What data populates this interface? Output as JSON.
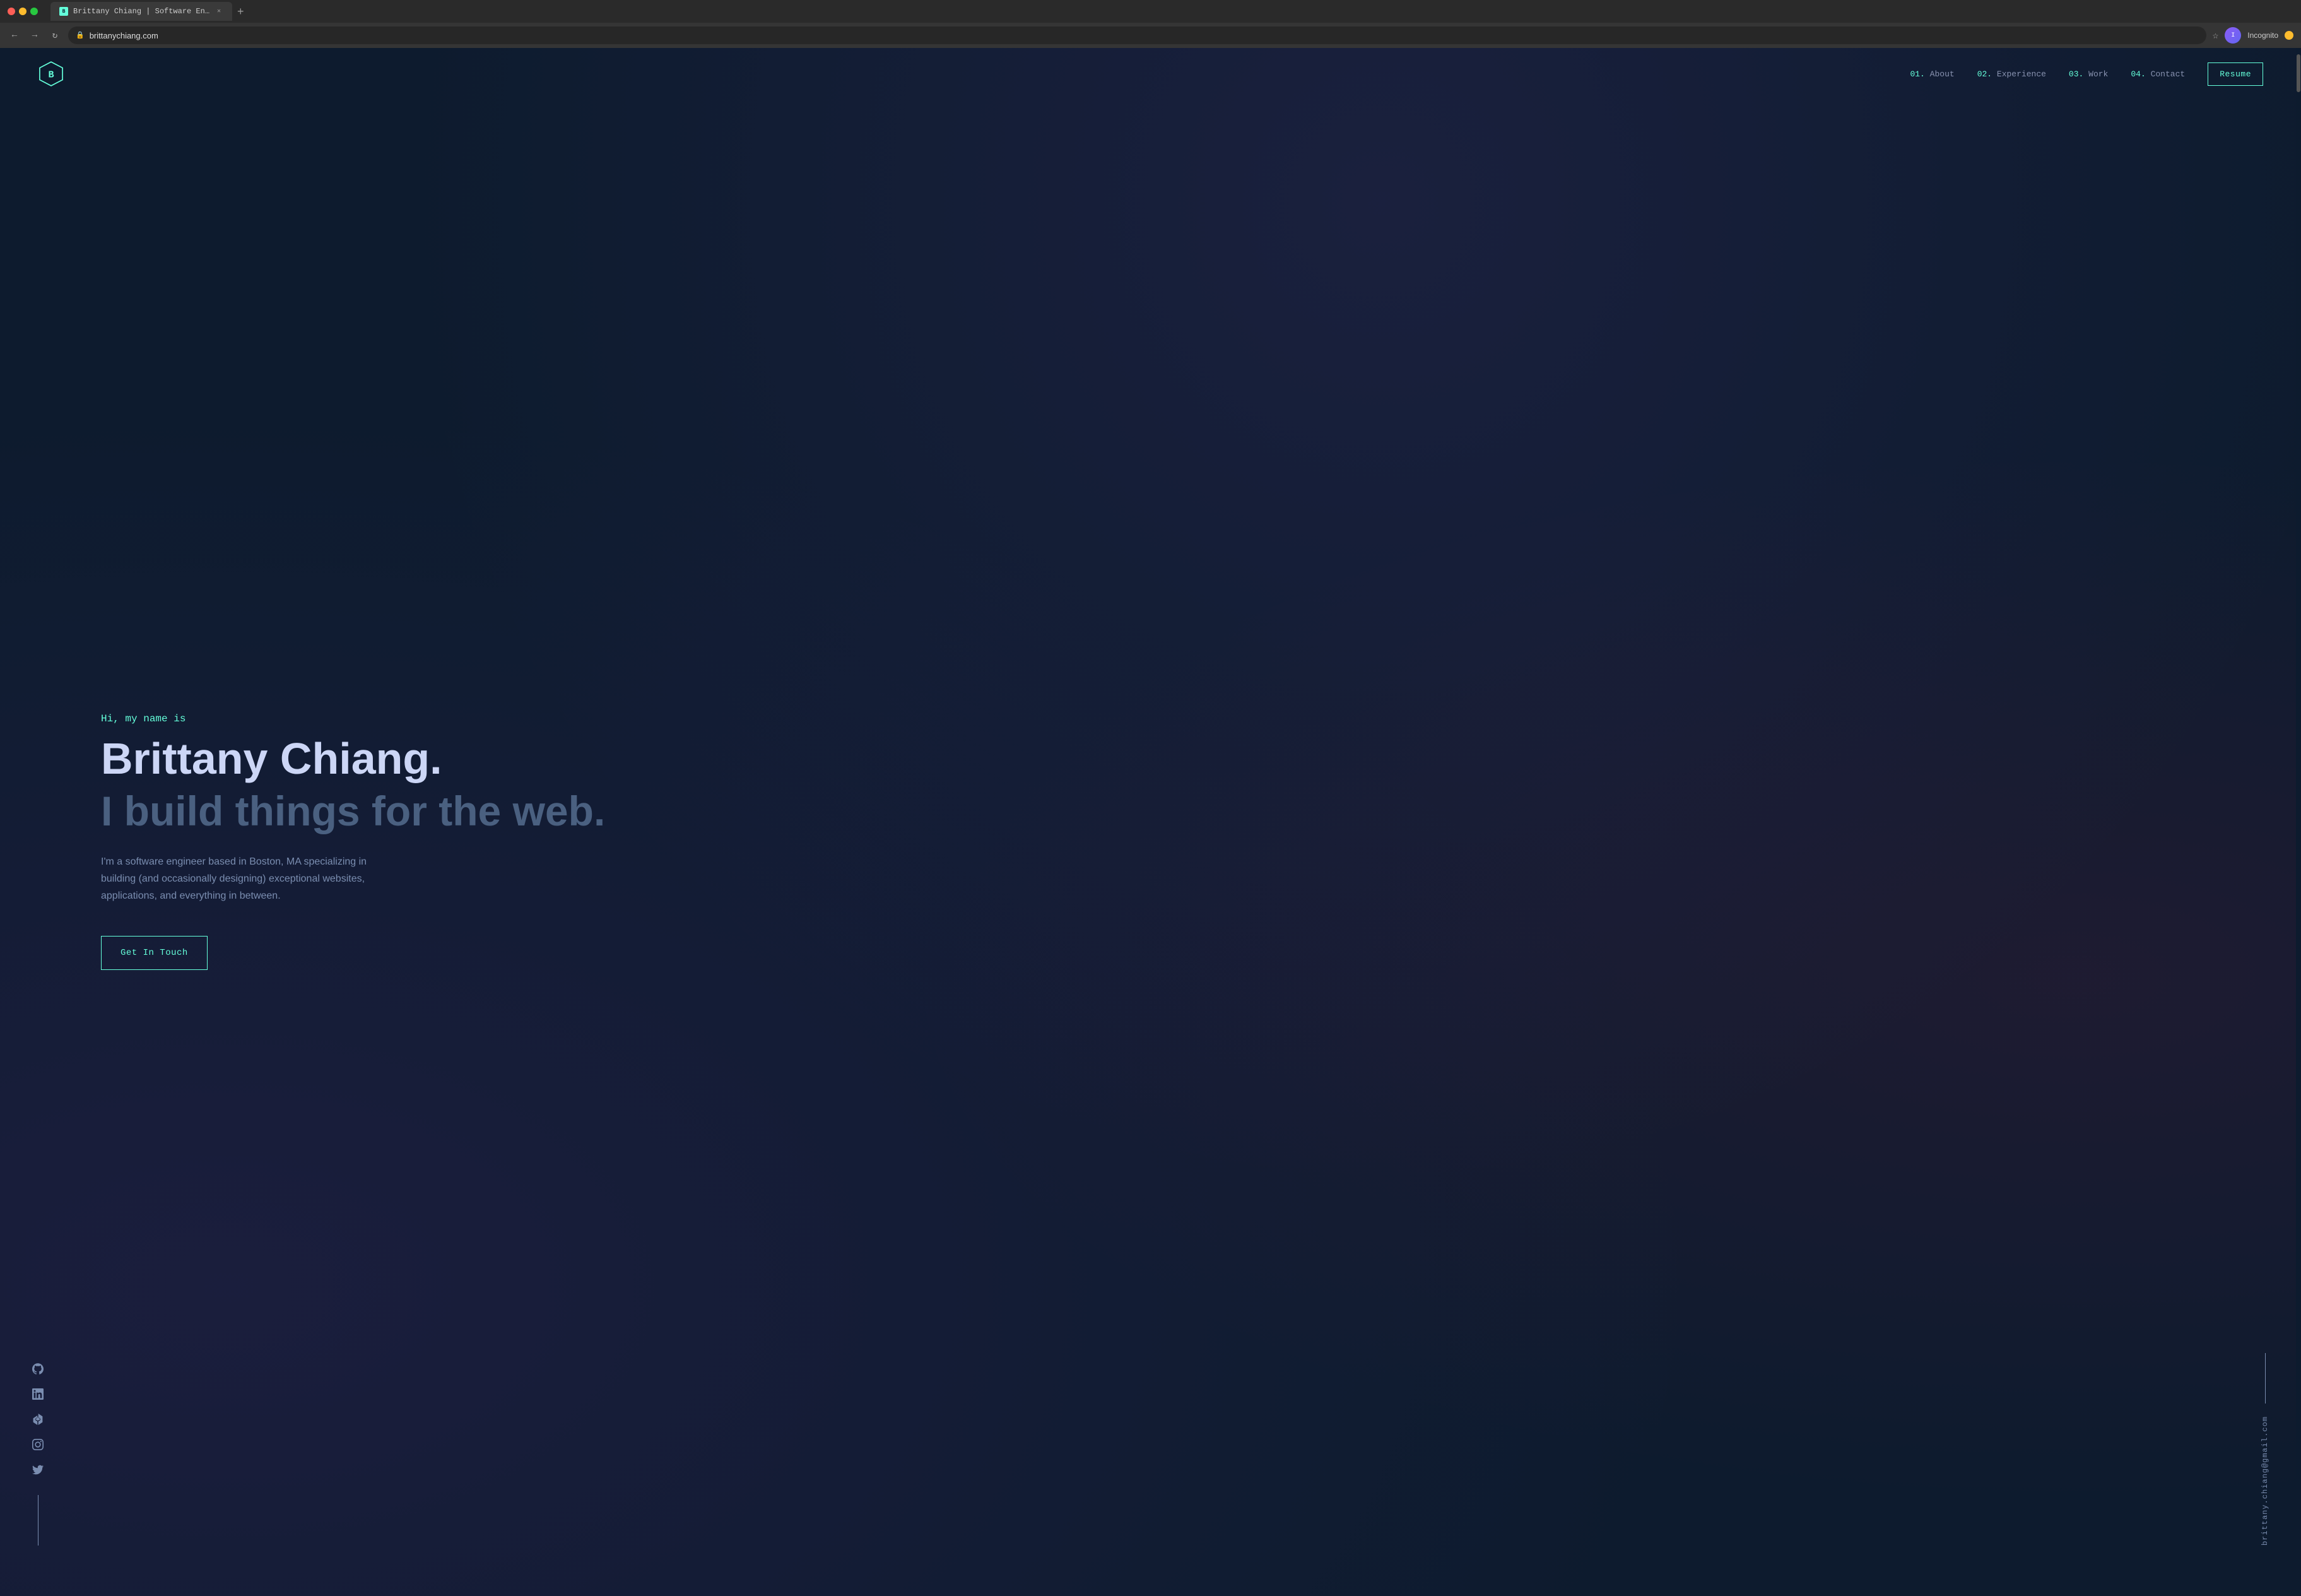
{
  "browser": {
    "tab_title": "Brittany Chiang | Software En…",
    "url": "brittanychiang.com",
    "profile_label": "Incognito"
  },
  "nav": {
    "logo_letter": "B",
    "links": [
      {
        "num": "01.",
        "label": "About"
      },
      {
        "num": "02.",
        "label": "Experience"
      },
      {
        "num": "03.",
        "label": "Work"
      },
      {
        "num": "04.",
        "label": "Contact"
      }
    ],
    "resume_btn": "Resume"
  },
  "hero": {
    "greeting": "Hi, my name is",
    "name": "Brittany Chiang.",
    "tagline": "I build things for the web.",
    "description": "I'm a software engineer based in Boston, MA specializing in building (and occasionally designing) exceptional websites, applications, and everything in between.",
    "cta_btn": "Get In Touch"
  },
  "social": {
    "icons": [
      "github",
      "linkedin",
      "codepen",
      "instagram",
      "twitter"
    ]
  },
  "email": {
    "address": "brittany.chiang@gmail.com"
  },
  "colors": {
    "teal": "#64ffda",
    "navy": "#0d1b2e",
    "text_primary": "#ccd6f6",
    "text_secondary": "#7a8db0",
    "text_muted": "#4a6080"
  }
}
